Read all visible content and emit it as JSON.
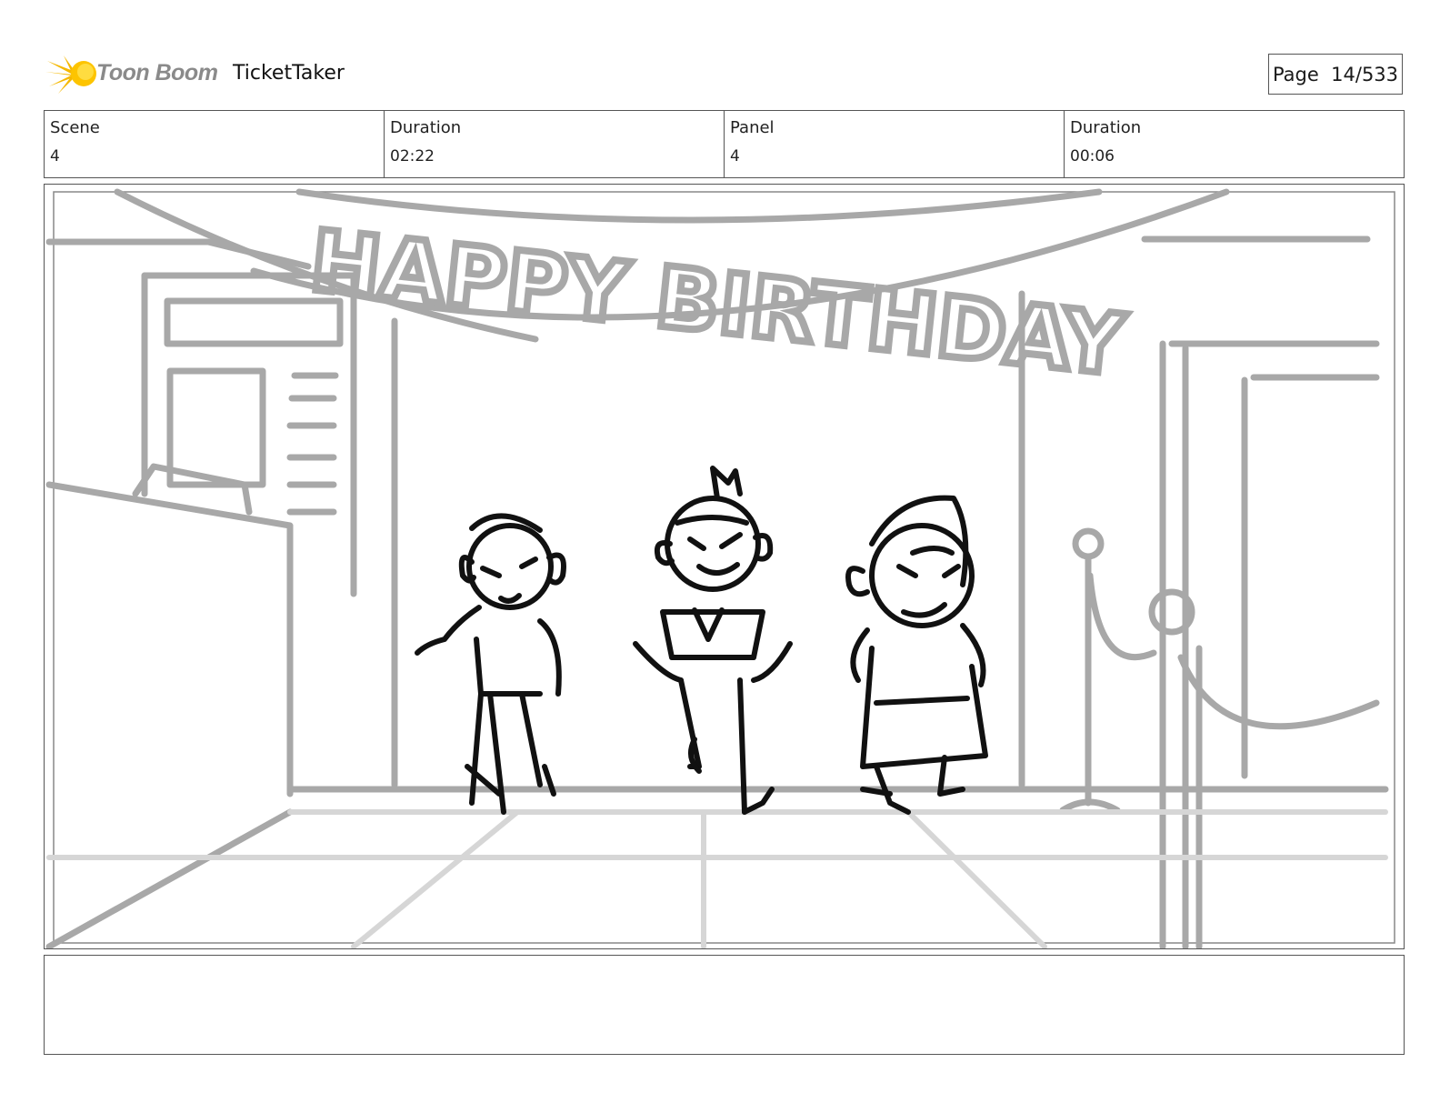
{
  "header": {
    "logo_text": "Toon Boom",
    "project_title": "TicketTaker",
    "page_label": "Page  14/533"
  },
  "info": {
    "scene_label": "Scene",
    "scene_value": "4",
    "scene_duration_label": "Duration",
    "scene_duration_value": "02:22",
    "panel_label": "Panel",
    "panel_value": "4",
    "panel_duration_label": "Duration",
    "panel_duration_value": "00:06"
  },
  "drawing": {
    "banner_text": "HAPPY BIRTHDAY",
    "icon": "sketch-image",
    "logo_icon": "toon-boom-sun-icon"
  },
  "notes": {
    "text": ""
  }
}
